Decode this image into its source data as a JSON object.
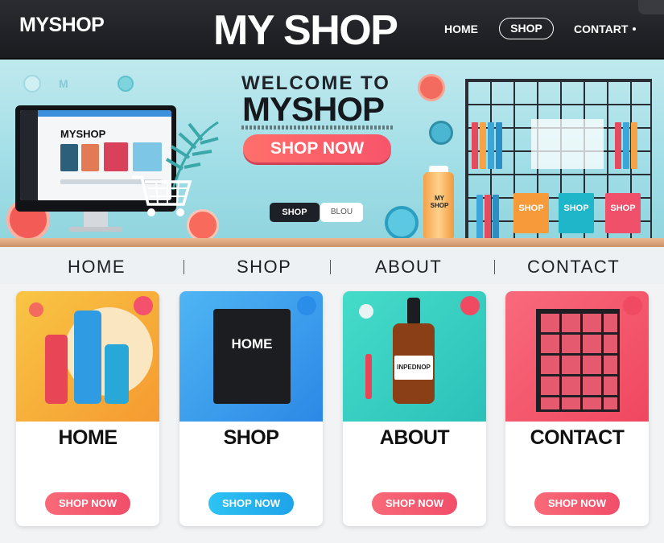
{
  "header": {
    "brand_left": "MYSHOP",
    "brand_tagline": "",
    "brand_center": "MY SHOP",
    "nav": {
      "home": "HOME",
      "shop": "SHOP",
      "contact": "CONTART"
    }
  },
  "hero": {
    "title_line1": "WELCOME TO",
    "title_line2": "MYSHOP",
    "cta": "SHOP NOW",
    "blurb": "",
    "btn_shop": "SHOP",
    "btn_blog": "BLOU",
    "monitor_brand": "MYSHOP",
    "bottle_label": "MY SHOP",
    "rack_boxes": [
      "SHOP",
      "SHOP",
      "SHOP"
    ]
  },
  "catnav": {
    "items": [
      "HOME",
      "SHOP",
      "ABOUT",
      "CONTACT"
    ]
  },
  "cards": [
    {
      "title": "HOME",
      "text": "",
      "button": "SHOP NOW",
      "accent": "#f86a78",
      "corner": "#f4516c"
    },
    {
      "title": "SHOP",
      "text": "",
      "button": "SHOP NOW",
      "accent": "#24b5ef",
      "corner": "#2a8ee8"
    },
    {
      "title": "ABOUT",
      "text": "",
      "button": "SHOP NOW",
      "accent": "#f35a6b",
      "corner": "#f04a62"
    },
    {
      "title": "CONTACT",
      "text": "",
      "button": "SHOP NOW",
      "accent": "#f6506a",
      "corner": "#f04a62"
    }
  ],
  "card_product_labels": {
    "home": "",
    "shop": "HOME",
    "about": "INPEDNOP"
  },
  "colors": {
    "header_bg": "#1f2025",
    "hero_bg": "#a8e1e8",
    "cta": "#f8546a",
    "card_home_top": "#f8b23a",
    "card_shop_top": "#3fa0f0",
    "card_about_top": "#3fd6c2",
    "card_contact_top": "#f44f69"
  }
}
